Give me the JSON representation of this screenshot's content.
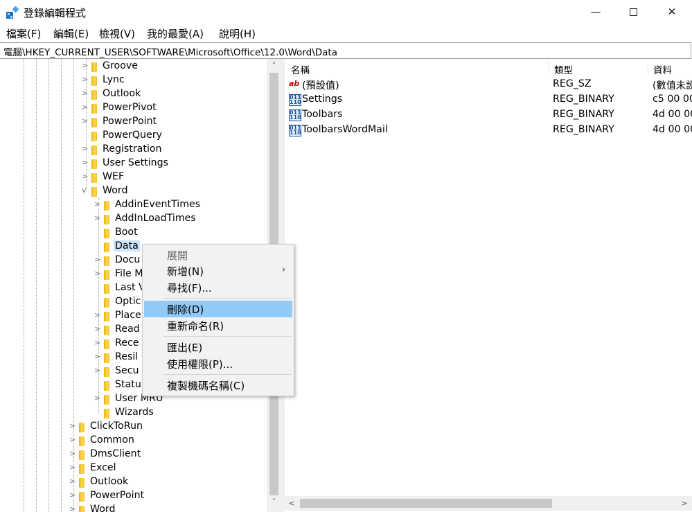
{
  "window": {
    "title": "登錄編輯程式",
    "controls": {
      "minimize": "—",
      "close": "✕"
    }
  },
  "menu": [
    "檔案(F)",
    "編輯(E)",
    "檢視(V)",
    "我的最愛(A)",
    "說明(H)"
  ],
  "address": "電腦\\HKEY_CURRENT_USER\\SOFTWARE\\Microsoft\\Office\\12.0\\Word\\Data",
  "tree": {
    "rows": [
      {
        "label": "Groove",
        "expander": ">"
      },
      {
        "label": "Lync",
        "expander": ">"
      },
      {
        "label": "Outlook",
        "expander": ">"
      },
      {
        "label": "PowerPivot",
        "expander": ">"
      },
      {
        "label": "PowerPoint",
        "expander": ">"
      },
      {
        "label": "PowerQuery",
        "expander": ""
      },
      {
        "label": "Registration",
        "expander": ">"
      },
      {
        "label": "User Settings",
        "expander": ">"
      },
      {
        "label": "WEF",
        "expander": ">"
      },
      {
        "label": "Word",
        "expander": "v"
      },
      {
        "label": "AddinEventTimes",
        "expander": ">"
      },
      {
        "label": "AddInLoadTimes",
        "expander": ">"
      },
      {
        "label": "Boot",
        "expander": ""
      },
      {
        "label": "Data",
        "expander": ""
      },
      {
        "label": "Docu",
        "expander": ">"
      },
      {
        "label": "File M",
        "expander": ">"
      },
      {
        "label": "Last V",
        "expander": ""
      },
      {
        "label": "Optic",
        "expander": ""
      },
      {
        "label": "Place",
        "expander": ">"
      },
      {
        "label": "Read",
        "expander": ">"
      },
      {
        "label": "Rece",
        "expander": ">"
      },
      {
        "label": "Resil",
        "expander": ">"
      },
      {
        "label": "Secu",
        "expander": ">"
      },
      {
        "label": "Statu",
        "expander": ""
      },
      {
        "label": "User MRU",
        "expander": ">"
      },
      {
        "label": "Wizards",
        "expander": ""
      },
      {
        "label": "ClickToRun",
        "expander": ">"
      },
      {
        "label": "Common",
        "expander": ">"
      },
      {
        "label": "DmsClient",
        "expander": ">"
      },
      {
        "label": "Excel",
        "expander": ">"
      },
      {
        "label": "Outlook",
        "expander": ">"
      },
      {
        "label": "PowerPoint",
        "expander": ">"
      },
      {
        "label": "Word",
        "expander": ">"
      }
    ],
    "selected": "Data"
  },
  "list": {
    "columns": [
      "名稱",
      "類型",
      "資料"
    ],
    "rows": [
      {
        "icon": "string-value-icon",
        "icon_text": "ab",
        "name": "(預設值)",
        "type": "REG_SZ",
        "data": "(數值未設"
      },
      {
        "icon": "binary-value-icon",
        "icon_text": "011\n110",
        "name": "Settings",
        "type": "REG_BINARY",
        "data": "c5 00 00"
      },
      {
        "icon": "binary-value-icon",
        "icon_text": "011\n110",
        "name": "Toolbars",
        "type": "REG_BINARY",
        "data": "4d 00 00"
      },
      {
        "icon": "binary-value-icon",
        "icon_text": "011\n110",
        "name": "ToolbarsWordMail",
        "type": "REG_BINARY",
        "data": "4d 00 00"
      }
    ]
  },
  "context_menu": {
    "items": [
      {
        "label": "展開",
        "disabled": true
      },
      {
        "label": "新增(N)",
        "submenu": true
      },
      {
        "label": "尋找(F)..."
      },
      {
        "label": "刪除(D)",
        "highlighted": true
      },
      {
        "label": "重新命名(R)"
      },
      {
        "label": "匯出(E)"
      },
      {
        "label": "使用權限(P)..."
      },
      {
        "label": "複製機碼名稱(C)"
      }
    ],
    "submenu_arrow": "›"
  },
  "scroll_glyphs": {
    "up": "˄",
    "down": "˅",
    "left": "<",
    "right": ">"
  },
  "colors": {
    "highlight": "#91c9f7",
    "selected_row": "#cce4f7",
    "folder": "#f2c12e"
  }
}
